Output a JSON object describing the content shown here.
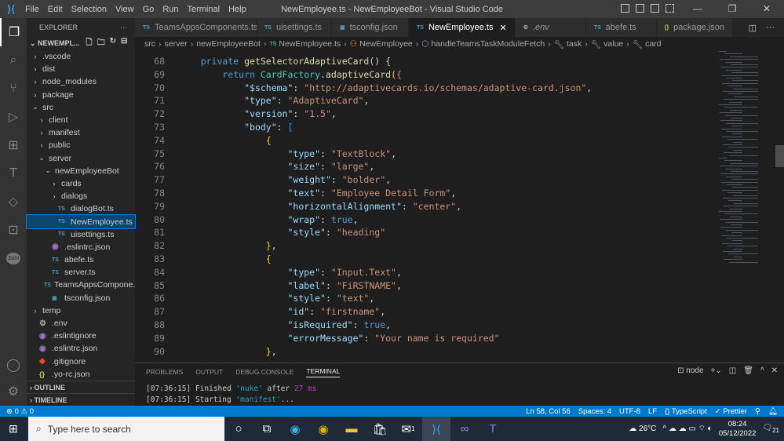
{
  "titlebar": {
    "menu": [
      "File",
      "Edit",
      "Selection",
      "View",
      "Go",
      "Run",
      "Terminal",
      "Help"
    ],
    "title": "NewEmployee.ts - NewEmployeeBot - Visual Studio Code"
  },
  "sidebar": {
    "header": "EXPLORER",
    "root": "NEWEMPL...",
    "items": [
      {
        "label": ".vscode",
        "depth": 0,
        "type": "folder",
        "open": false
      },
      {
        "label": "dist",
        "depth": 0,
        "type": "folder",
        "open": false
      },
      {
        "label": "node_modules",
        "depth": 0,
        "type": "folder",
        "open": false
      },
      {
        "label": "package",
        "depth": 0,
        "type": "folder",
        "open": false
      },
      {
        "label": "src",
        "depth": 0,
        "type": "folder",
        "open": true
      },
      {
        "label": "client",
        "depth": 1,
        "type": "folder",
        "open": false
      },
      {
        "label": "manifest",
        "depth": 1,
        "type": "folder",
        "open": false
      },
      {
        "label": "public",
        "depth": 1,
        "type": "folder",
        "open": false
      },
      {
        "label": "server",
        "depth": 1,
        "type": "folder",
        "open": true
      },
      {
        "label": "newEmployeeBot",
        "depth": 2,
        "type": "folder",
        "open": true
      },
      {
        "label": "cards",
        "depth": 3,
        "type": "folder",
        "open": false
      },
      {
        "label": "dialogs",
        "depth": 3,
        "type": "folder",
        "open": false
      },
      {
        "label": "dialogBot.ts",
        "depth": 3,
        "type": "ts"
      },
      {
        "label": "NewEmployee.ts",
        "depth": 3,
        "type": "ts",
        "selected": true
      },
      {
        "label": "uisettings.ts",
        "depth": 3,
        "type": "ts"
      },
      {
        "label": ".eslintrc.json",
        "depth": 2,
        "type": "eslint"
      },
      {
        "label": "abefe.ts",
        "depth": 2,
        "type": "ts"
      },
      {
        "label": "server.ts",
        "depth": 2,
        "type": "ts"
      },
      {
        "label": "TeamsAppsCompone...",
        "depth": 2,
        "type": "ts"
      },
      {
        "label": "tsconfig.json",
        "depth": 2,
        "type": "tsconfig"
      },
      {
        "label": "temp",
        "depth": 0,
        "type": "folder",
        "open": false
      },
      {
        "label": ".env",
        "depth": 0,
        "type": "gear"
      },
      {
        "label": ".eslintignore",
        "depth": 0,
        "type": "eslint"
      },
      {
        "label": ".eslintrc.json",
        "depth": 0,
        "type": "eslint"
      },
      {
        "label": ".gitignore",
        "depth": 0,
        "type": "git"
      },
      {
        "label": ".yo-rc.json",
        "depth": 0,
        "type": "json"
      }
    ],
    "sections": [
      "OUTLINE",
      "TIMELINE"
    ]
  },
  "tabs": [
    {
      "label": "TeamsAppsComponents.ts",
      "icon": "TS"
    },
    {
      "label": "uisettings.ts",
      "icon": "TS"
    },
    {
      "label": "tsconfig.json",
      "icon": "tsconfig"
    },
    {
      "label": "NewEmployee.ts",
      "icon": "TS",
      "active": true
    },
    {
      "label": ".env",
      "icon": "gear"
    },
    {
      "label": "abefe.ts",
      "icon": "TS"
    },
    {
      "label": "package.json",
      "icon": "{}"
    }
  ],
  "ts_badge": "TS",
  "json_badge": "{}",
  "breadcrumb": [
    "src",
    "server",
    "newEmployeeBot",
    "NewEmployee.ts",
    "NewEmployee",
    "handleTeamsTaskModuleFetch",
    "task",
    "value",
    "card"
  ],
  "code": [
    {
      "n": "68",
      "t": [
        [
          "d",
          "    "
        ],
        [
          "k",
          "private "
        ],
        [
          "f",
          "getSelectorAdaptiveCard"
        ],
        [
          "d",
          "() {"
        ]
      ]
    },
    {
      "n": "69",
      "t": [
        [
          "d",
          "        "
        ],
        [
          "k",
          "return "
        ],
        [
          "c",
          "CardFactory"
        ],
        [
          "d",
          "."
        ],
        [
          "f",
          "adaptiveCard"
        ],
        [
          "b1",
          "("
        ],
        [
          "b2",
          "{"
        ]
      ]
    },
    {
      "n": "70",
      "t": [
        [
          "d",
          "            "
        ],
        [
          "p",
          "\"$schema\""
        ],
        [
          "d",
          ": "
        ],
        [
          "s",
          "\"http://adaptivecards.io/schemas/adaptive-card.json\""
        ],
        [
          "d",
          ","
        ]
      ]
    },
    {
      "n": "71",
      "t": [
        [
          "d",
          "            "
        ],
        [
          "p",
          "\"type\""
        ],
        [
          "d",
          ": "
        ],
        [
          "s",
          "\"AdaptiveCard\""
        ],
        [
          "d",
          ","
        ]
      ]
    },
    {
      "n": "72",
      "t": [
        [
          "d",
          "            "
        ],
        [
          "p",
          "\"version\""
        ],
        [
          "d",
          ": "
        ],
        [
          "s",
          "\"1.5\""
        ],
        [
          "d",
          ","
        ]
      ]
    },
    {
      "n": "73",
      "t": [
        [
          "d",
          "            "
        ],
        [
          "p",
          "\"body\""
        ],
        [
          "d",
          ": "
        ],
        [
          "b3",
          "["
        ]
      ]
    },
    {
      "n": "74",
      "t": [
        [
          "d",
          "                "
        ],
        [
          "b1",
          "{"
        ]
      ]
    },
    {
      "n": "75",
      "t": [
        [
          "d",
          "                    "
        ],
        [
          "p",
          "\"type\""
        ],
        [
          "d",
          ": "
        ],
        [
          "s",
          "\"TextBlock\""
        ],
        [
          "d",
          ","
        ]
      ]
    },
    {
      "n": "76",
      "t": [
        [
          "d",
          "                    "
        ],
        [
          "p",
          "\"size\""
        ],
        [
          "d",
          ": "
        ],
        [
          "s",
          "\"large\""
        ],
        [
          "d",
          ","
        ]
      ]
    },
    {
      "n": "77",
      "t": [
        [
          "d",
          "                    "
        ],
        [
          "p",
          "\"weight\""
        ],
        [
          "d",
          ": "
        ],
        [
          "s",
          "\"bolder\""
        ],
        [
          "d",
          ","
        ]
      ]
    },
    {
      "n": "78",
      "t": [
        [
          "d",
          "                    "
        ],
        [
          "p",
          "\"text\""
        ],
        [
          "d",
          ": "
        ],
        [
          "s",
          "\"Employee Detail Form\""
        ],
        [
          "d",
          ","
        ]
      ]
    },
    {
      "n": "79",
      "t": [
        [
          "d",
          "                    "
        ],
        [
          "p",
          "\"horizontalAlignment\""
        ],
        [
          "d",
          ": "
        ],
        [
          "s",
          "\"center\""
        ],
        [
          "d",
          ","
        ]
      ]
    },
    {
      "n": "80",
      "t": [
        [
          "d",
          "                    "
        ],
        [
          "p",
          "\"wrap\""
        ],
        [
          "d",
          ": "
        ],
        [
          "k",
          "true"
        ],
        [
          "d",
          ","
        ]
      ]
    },
    {
      "n": "81",
      "t": [
        [
          "d",
          "                    "
        ],
        [
          "p",
          "\"style\""
        ],
        [
          "d",
          ": "
        ],
        [
          "s",
          "\"heading\""
        ]
      ]
    },
    {
      "n": "82",
      "t": [
        [
          "d",
          "                "
        ],
        [
          "b1",
          "}"
        ],
        [
          "d",
          ","
        ]
      ]
    },
    {
      "n": "83",
      "t": [
        [
          "d",
          "                "
        ],
        [
          "b1",
          "{"
        ]
      ]
    },
    {
      "n": "84",
      "t": [
        [
          "d",
          "                    "
        ],
        [
          "p",
          "\"type\""
        ],
        [
          "d",
          ": "
        ],
        [
          "s",
          "\"Input.Text\""
        ],
        [
          "d",
          ","
        ]
      ]
    },
    {
      "n": "85",
      "t": [
        [
          "d",
          "                    "
        ],
        [
          "p",
          "\"label\""
        ],
        [
          "d",
          ": "
        ],
        [
          "s",
          "\"FiRSTNAME\""
        ],
        [
          "d",
          ","
        ]
      ]
    },
    {
      "n": "86",
      "t": [
        [
          "d",
          "                    "
        ],
        [
          "p",
          "\"style\""
        ],
        [
          "d",
          ": "
        ],
        [
          "s",
          "\"text\""
        ],
        [
          "d",
          ","
        ]
      ]
    },
    {
      "n": "87",
      "t": [
        [
          "d",
          "                    "
        ],
        [
          "p",
          "\"id\""
        ],
        [
          "d",
          ": "
        ],
        [
          "s",
          "\"firstname\""
        ],
        [
          "d",
          ","
        ]
      ]
    },
    {
      "n": "88",
      "t": [
        [
          "d",
          "                    "
        ],
        [
          "p",
          "\"isRequired\""
        ],
        [
          "d",
          ": "
        ],
        [
          "k",
          "true"
        ],
        [
          "d",
          ","
        ]
      ]
    },
    {
      "n": "89",
      "t": [
        [
          "d",
          "                    "
        ],
        [
          "p",
          "\"errorMessage\""
        ],
        [
          "d",
          ": "
        ],
        [
          "s",
          "\"Your name is required\""
        ]
      ]
    },
    {
      "n": "90",
      "t": [
        [
          "d",
          "                "
        ],
        [
          "b1",
          "}"
        ],
        [
          "d",
          ","
        ]
      ]
    }
  ],
  "panel": {
    "tabs": [
      "PROBLEMS",
      "OUTPUT",
      "DEBUG CONSOLE",
      "TERMINAL"
    ],
    "active": "TERMINAL",
    "shell": "node",
    "lines": [
      {
        "time": "[07:36:15]",
        "verb": "Finished",
        "task": "'nuke'",
        "mid": "after",
        "num": "27 ms",
        "end": ""
      },
      {
        "time": "[07:36:15]",
        "verb": "Starting",
        "task": "'manifest'",
        "mid": "",
        "num": "",
        "end": "..."
      }
    ]
  },
  "status": {
    "errors": "0",
    "warnings": "0",
    "position": "Ln 58, Col 56",
    "spaces": "Spaces: 4",
    "encoding": "UTF-8",
    "eol": "LF",
    "language": "TypeScript",
    "formatter": "Prettier"
  },
  "taskbar": {
    "search_placeholder": "Type here to search",
    "weather": "26°C",
    "time": "08:24",
    "date": "05/12/2022",
    "notifications": "21",
    "mail_badge": "1"
  },
  "colors": {
    "accent": "#007acc",
    "selection": "#094771"
  }
}
